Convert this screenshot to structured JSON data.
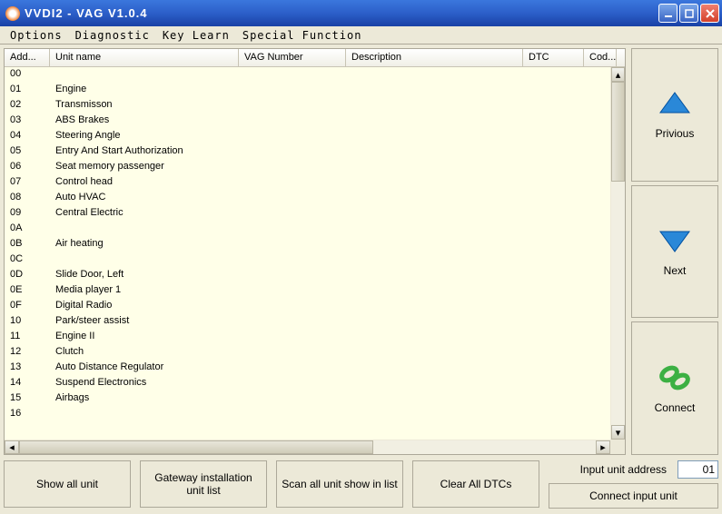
{
  "window": {
    "title": "VVDI2 - VAG V1.0.4"
  },
  "menu": {
    "options": "Options",
    "diagnostic": "Diagnostic",
    "keylearn": "Key Learn",
    "special": "Special Function"
  },
  "columns": {
    "add": "Add...",
    "unit": "Unit name",
    "vag": "VAG Number",
    "desc": "Description",
    "dtc": "DTC",
    "cod": "Cod..."
  },
  "rows": [
    {
      "addr": "00",
      "name": ""
    },
    {
      "addr": "01",
      "name": "Engine"
    },
    {
      "addr": "02",
      "name": "Transmisson"
    },
    {
      "addr": "03",
      "name": "ABS Brakes"
    },
    {
      "addr": "04",
      "name": "Steering Angle"
    },
    {
      "addr": "05",
      "name": "Entry And Start Authorization"
    },
    {
      "addr": "06",
      "name": "Seat memory passenger"
    },
    {
      "addr": "07",
      "name": "Control head"
    },
    {
      "addr": "08",
      "name": "Auto HVAC"
    },
    {
      "addr": "09",
      "name": "Central Electric"
    },
    {
      "addr": "0A",
      "name": ""
    },
    {
      "addr": "0B",
      "name": "Air heating"
    },
    {
      "addr": "0C",
      "name": ""
    },
    {
      "addr": "0D",
      "name": "Slide Door, Left"
    },
    {
      "addr": "0E",
      "name": "Media player 1"
    },
    {
      "addr": "0F",
      "name": "Digital Radio"
    },
    {
      "addr": "10",
      "name": "Park/steer assist"
    },
    {
      "addr": "11",
      "name": "Engine II"
    },
    {
      "addr": "12",
      "name": "Clutch"
    },
    {
      "addr": "13",
      "name": "Auto Distance Regulator"
    },
    {
      "addr": "14",
      "name": "Suspend Electronics"
    },
    {
      "addr": "15",
      "name": "Airbags"
    },
    {
      "addr": "16",
      "name": ""
    }
  ],
  "side": {
    "previous": "Privious",
    "next": "Next",
    "connect": "Connect"
  },
  "buttons": {
    "showall": "Show all unit",
    "gateway": "Gateway installation unit list",
    "scan": "Scan all unit show in list",
    "clear": "Clear All DTCs",
    "inputlabel": "Input unit address",
    "connect_input": "Connect input unit"
  },
  "input": {
    "address": "01"
  }
}
